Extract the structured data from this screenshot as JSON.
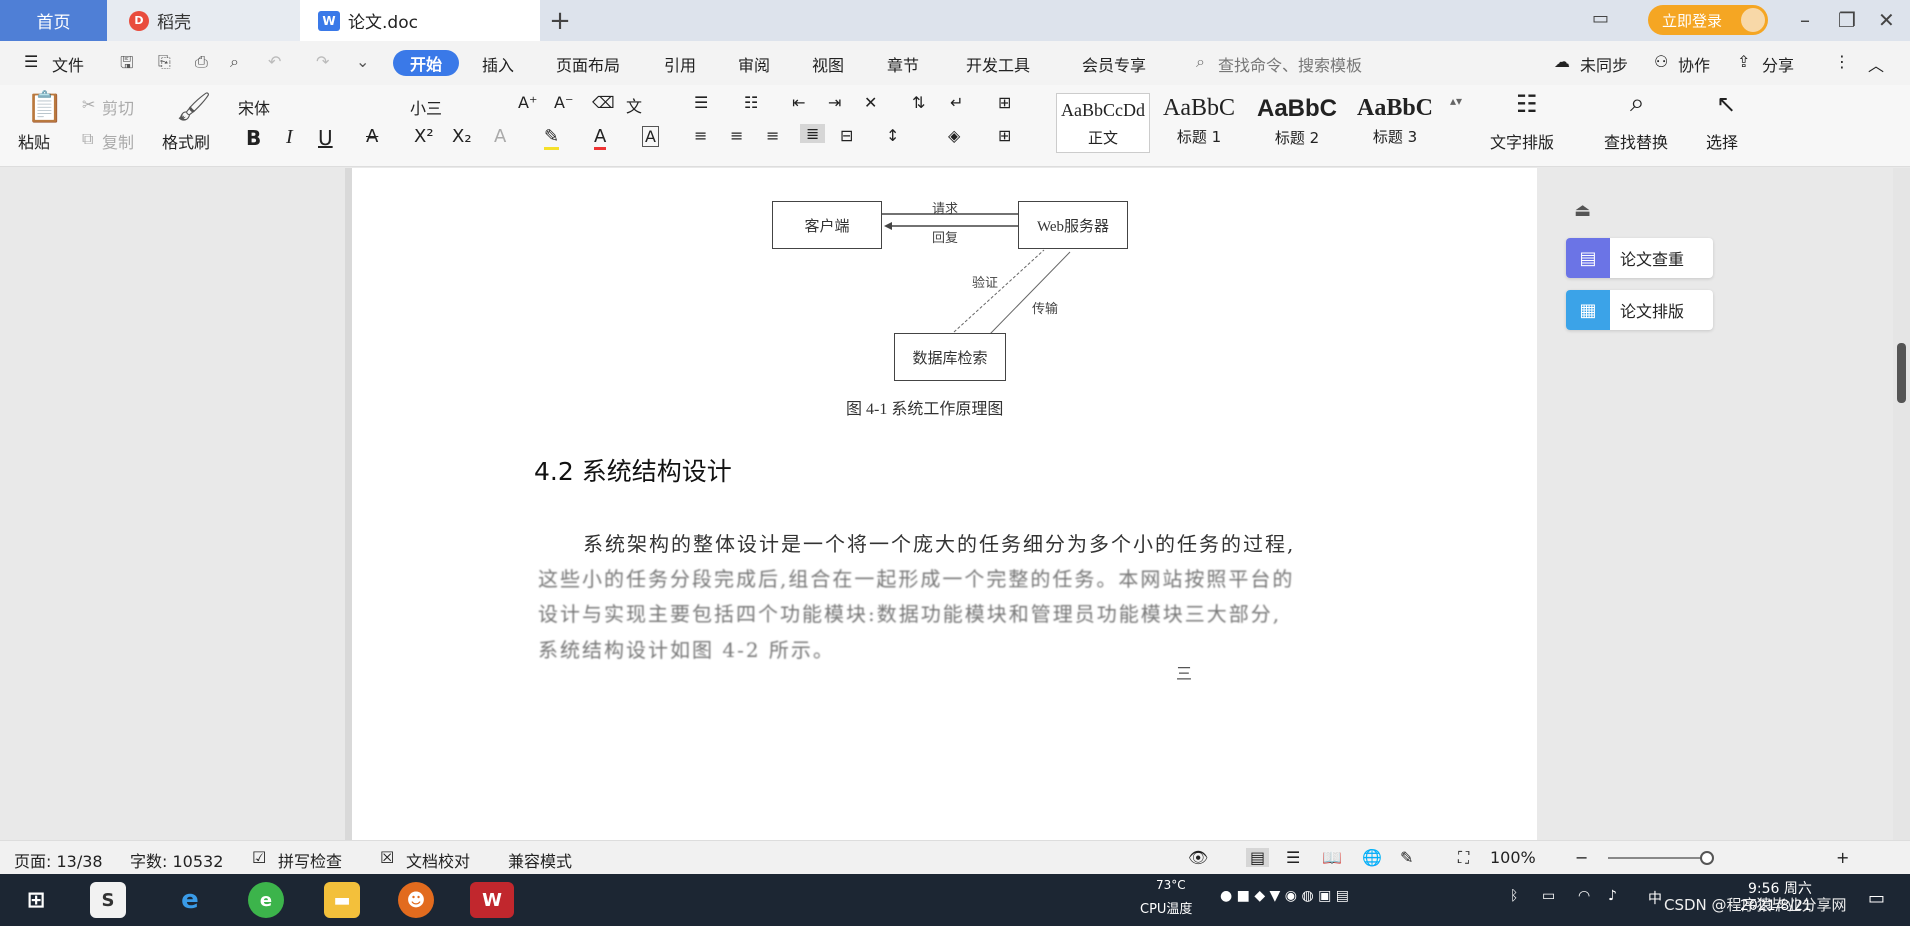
{
  "titlebar": {
    "tabs": [
      {
        "label": "首页"
      },
      {
        "label": "稻壳"
      },
      {
        "label": "论文.doc"
      }
    ],
    "login_label": "立即登录"
  },
  "menubar": {
    "file": "文件",
    "items": [
      "开始",
      "插入",
      "页面布局",
      "引用",
      "审阅",
      "视图",
      "章节",
      "开发工具",
      "会员专享"
    ],
    "search_placeholder": "查找命令、搜索模板",
    "sync": "未同步",
    "collab": "协作",
    "share": "分享"
  },
  "ribbon": {
    "paste": "粘贴",
    "cut": "剪切",
    "copy": "复制",
    "format_painter": "格式刷",
    "font_name": "宋体",
    "font_size": "小三",
    "styles": [
      {
        "preview": "AaBbCcDd",
        "name": "正文"
      },
      {
        "preview": "AaBbC",
        "name": "标题 1"
      },
      {
        "preview": "AaBbC",
        "name": "标题 2"
      },
      {
        "preview": "AaBbC",
        "name": "标题 3"
      }
    ],
    "text_layout": "文字排版",
    "find_replace": "查找替换",
    "select": "选择"
  },
  "document": {
    "diagram": {
      "client": "客户端",
      "server": "Web服务器",
      "database": "数据库检索",
      "request": "请求",
      "response": "回复",
      "verify": "验证",
      "transfer": "传输",
      "caption": "图 4-1  系统工作原理图"
    },
    "heading": "4.2 系统结构设计",
    "paragraph_lines": [
      "系统架构的整体设计是一个将一个庞大的任务细分为多个小的任务的过程,",
      "这些小的任务分段完成后,组合在一起形成一个完整的任务。本网站按照平台的",
      "设计与实现主要包括四个功能模块:数据功能模块和管理员功能模块三大部分,",
      "系统结构设计如图 4-2 所示。"
    ],
    "page_marker": "三"
  },
  "side_panel": {
    "check": "论文查重",
    "format": "论文排版"
  },
  "statusbar": {
    "page": "页面: 13/38",
    "words": "字数: 10532",
    "spell": "拼写检查",
    "proof": "文档校对",
    "compat": "兼容模式",
    "zoom": "100%"
  },
  "taskbar": {
    "temp": "73°C",
    "cpu": "CPU温度",
    "time": "9:56 周六",
    "date": "2021/8/21",
    "ime": "中",
    "watermark": "CSDN @程序猿毕业分享网"
  },
  "colors": {
    "accent": "#3a79e8",
    "login": "#f5a623",
    "taskbar": "#1c2633"
  }
}
